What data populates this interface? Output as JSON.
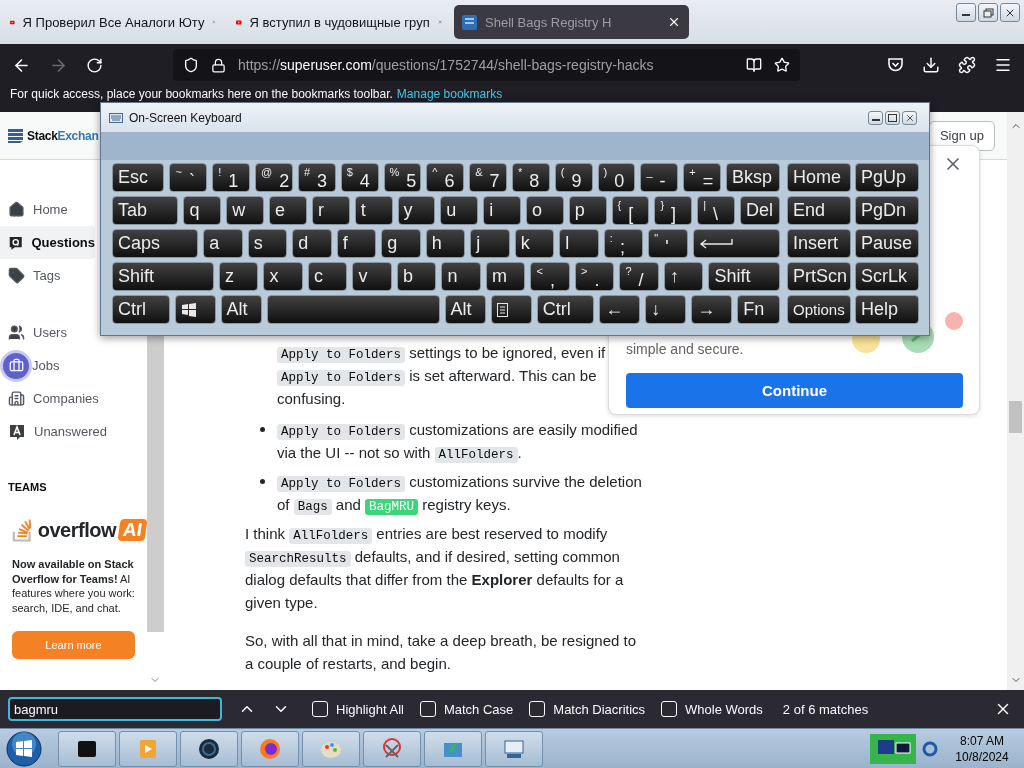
{
  "browser": {
    "tabs": [
      {
        "title": "Я Проверил Все Аналоги Юту",
        "selected": false
      },
      {
        "title": "Я вступил в чудовищные груп",
        "selected": false
      },
      {
        "title": "Shell Bags Registry H",
        "selected": true
      }
    ],
    "url": {
      "scheme": "https://",
      "host": "superuser.com",
      "path": "/questions/1752744/shell-bags-registry-hacks"
    },
    "forward_button": {
      "disabled": true
    },
    "bookmarks_bar": {
      "message": "For quick access, place your bookmarks here on the bookmarks toolbar.",
      "link": "Manage bookmarks"
    }
  },
  "site_header": {
    "brand_dark": "Stack",
    "brand_blue": "Exchan",
    "signup_button": "Sign up"
  },
  "sidebar": {
    "primary": [
      {
        "label": "Home",
        "selected": false,
        "highlighted": false
      },
      {
        "label": "Questions",
        "selected": true,
        "highlighted": false
      },
      {
        "label": "Tags",
        "selected": false,
        "highlighted": false
      }
    ],
    "secondary": [
      {
        "label": "Users",
        "selected": false,
        "highlighted": false
      },
      {
        "label": "Jobs",
        "selected": false,
        "highlighted": true
      },
      {
        "label": "Companies",
        "selected": false,
        "highlighted": false
      },
      {
        "label": "Unanswered",
        "selected": false,
        "highlighted": false
      }
    ],
    "teams_heading": "TEAMS",
    "promo": {
      "logo_text": "overflow",
      "logo_badge": "AI",
      "text": "**Now available on Stack Overflow for Teams!** AI features where you work: search, IDE, and chat.",
      "button": "Learn more"
    }
  },
  "answer": [
    {
      "kind": "continuation",
      "parts": [
        {
          "kind": "code",
          "text": "Apply to Folders"
        },
        {
          "kind": "text",
          "text": " settings to be ignored, even if "
        },
        {
          "kind": "code",
          "text": "Apply to Folders"
        },
        {
          "kind": "text",
          "text": " is set afterward. This can be confusing."
        }
      ]
    },
    {
      "kind": "bullet",
      "parts": [
        {
          "kind": "code",
          "text": "Apply to Folders"
        },
        {
          "kind": "text",
          "text": " customizations are easily modified via the UI -- not so with "
        },
        {
          "kind": "code",
          "text": "AllFolders"
        },
        {
          "kind": "text",
          "text": "."
        }
      ]
    },
    {
      "kind": "bullet",
      "parts": [
        {
          "kind": "code",
          "text": "Apply to Folders"
        },
        {
          "kind": "text",
          "text": " customizations survive the deletion of "
        },
        {
          "kind": "code",
          "text": "Bags"
        },
        {
          "kind": "text",
          "text": " and "
        },
        {
          "kind": "match",
          "text": "BagMRU"
        },
        {
          "kind": "text",
          "text": " registry keys."
        }
      ]
    },
    {
      "kind": "paragraph",
      "parts": [
        {
          "kind": "text",
          "text": "I think "
        },
        {
          "kind": "code",
          "text": "AllFolders"
        },
        {
          "kind": "text",
          "text": " entries are best reserved to modify "
        },
        {
          "kind": "code",
          "text": "SearchResults"
        },
        {
          "kind": "text",
          "text": " defaults, and if desired, setting common dialog defaults that differ from the "
        },
        {
          "kind": "bold",
          "text": "Explorer"
        },
        {
          "kind": "text",
          "text": " defaults for a given type."
        }
      ]
    },
    {
      "kind": "paragraph",
      "parts": [
        {
          "kind": "text",
          "text": "So, with all that in mind, take a deep breath, be resigned to a couple of restarts, and begin."
        }
      ]
    }
  ],
  "popup": {
    "text": "simple and secure.",
    "button": "Continue"
  },
  "keyboard": {
    "title": "On-Screen Keyboard",
    "rows": [
      {
        "keys": [
          {
            "kind": "text",
            "label": "Esc"
          },
          {
            "kind": "text",
            "label": "`",
            "shift": "~"
          },
          {
            "kind": "text",
            "label": "1",
            "shift": "!"
          },
          {
            "kind": "text",
            "label": "2",
            "shift": "@"
          },
          {
            "kind": "text",
            "label": "3",
            "shift": "#"
          },
          {
            "kind": "text",
            "label": "4",
            "shift": "$"
          },
          {
            "kind": "text",
            "label": "5",
            "shift": "%"
          },
          {
            "kind": "text",
            "label": "6",
            "shift": "^"
          },
          {
            "kind": "text",
            "label": "7",
            "shift": "&"
          },
          {
            "kind": "text",
            "label": "8",
            "shift": "*"
          },
          {
            "kind": "text",
            "label": "9",
            "shift": "("
          },
          {
            "kind": "text",
            "label": "0",
            "shift": ")"
          },
          {
            "kind": "text",
            "label": "-",
            "shift": "_"
          },
          {
            "kind": "text",
            "label": "=",
            "shift": "+"
          },
          {
            "kind": "text",
            "label": "Bksp"
          }
        ],
        "nav": [
          "Home",
          "PgUp"
        ]
      },
      {
        "keys": [
          {
            "kind": "text",
            "label": "Tab"
          },
          {
            "kind": "text",
            "label": "q"
          },
          {
            "kind": "text",
            "label": "w"
          },
          {
            "kind": "text",
            "label": "e"
          },
          {
            "kind": "text",
            "label": "r"
          },
          {
            "kind": "text",
            "label": "t"
          },
          {
            "kind": "text",
            "label": "y"
          },
          {
            "kind": "text",
            "label": "u"
          },
          {
            "kind": "text",
            "label": "i"
          },
          {
            "kind": "text",
            "label": "o"
          },
          {
            "kind": "text",
            "label": "p"
          },
          {
            "kind": "text",
            "label": "[",
            "shift": "{"
          },
          {
            "kind": "text",
            "label": "]",
            "shift": "}"
          },
          {
            "kind": "text",
            "label": "\\",
            "shift": "|"
          },
          {
            "kind": "text",
            "label": "Del"
          }
        ],
        "nav": [
          "End",
          "PgDn"
        ]
      },
      {
        "keys": [
          {
            "kind": "text",
            "label": "Caps"
          },
          {
            "kind": "text",
            "label": "a"
          },
          {
            "kind": "text",
            "label": "s"
          },
          {
            "kind": "text",
            "label": "d"
          },
          {
            "kind": "text",
            "label": "f"
          },
          {
            "kind": "text",
            "label": "g"
          },
          {
            "kind": "text",
            "label": "h"
          },
          {
            "kind": "text",
            "label": "j"
          },
          {
            "kind": "text",
            "label": "k"
          },
          {
            "kind": "text",
            "label": "l"
          },
          {
            "kind": "text",
            "label": ";",
            "shift": ":"
          },
          {
            "kind": "text",
            "label": "'",
            "shift": "\""
          },
          {
            "kind": "enter"
          }
        ],
        "nav": [
          "Insert",
          "Pause"
        ]
      },
      {
        "keys": [
          {
            "kind": "text",
            "label": "Shift"
          },
          {
            "kind": "text",
            "label": "z"
          },
          {
            "kind": "text",
            "label": "x"
          },
          {
            "kind": "text",
            "label": "c"
          },
          {
            "kind": "text",
            "label": "v"
          },
          {
            "kind": "text",
            "label": "b"
          },
          {
            "kind": "text",
            "label": "n"
          },
          {
            "kind": "text",
            "label": "m"
          },
          {
            "kind": "text",
            "label": ",",
            "shift": "<"
          },
          {
            "kind": "text",
            "label": ".",
            "shift": ">"
          },
          {
            "kind": "text",
            "label": "/",
            "shift": "?"
          },
          {
            "kind": "text",
            "label": "↑"
          },
          {
            "kind": "text",
            "label": "Shift"
          }
        ],
        "nav": [
          "PrtScn",
          "ScrLk"
        ]
      },
      {
        "keys": [
          {
            "kind": "text",
            "label": "Ctrl"
          },
          {
            "kind": "windows"
          },
          {
            "kind": "text",
            "label": "Alt"
          },
          {
            "kind": "space"
          },
          {
            "kind": "text",
            "label": "Alt"
          },
          {
            "kind": "menu"
          },
          {
            "kind": "text",
            "label": "Ctrl"
          },
          {
            "kind": "text",
            "label": "←"
          },
          {
            "kind": "text",
            "label": "↓"
          },
          {
            "kind": "text",
            "label": "→"
          },
          {
            "kind": "text",
            "label": "Fn"
          }
        ],
        "nav": [
          "Options",
          "Help"
        ]
      }
    ]
  },
  "find_bar": {
    "query": "bagmru",
    "options": [
      {
        "label": "Highlight All",
        "checked": false
      },
      {
        "label": "Match Case",
        "checked": false
      },
      {
        "label": "Match Diacritics",
        "checked": false
      },
      {
        "label": "Whole Words",
        "checked": false
      }
    ],
    "status": "2 of 6 matches"
  },
  "taskbar": {
    "time": "8:07 AM",
    "date": "10/8/2024"
  }
}
